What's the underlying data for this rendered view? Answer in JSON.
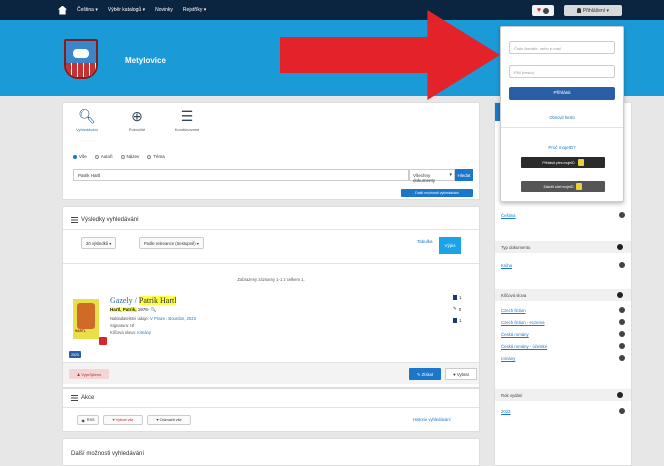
{
  "topnav": {
    "items": [
      "Čeština ▾",
      "Výběr katalogů ▾",
      "Novinky",
      "Rejstříky ▾"
    ],
    "login_button": "Přihlášení ▾"
  },
  "header": {
    "site_title": "Metylovice"
  },
  "search": {
    "tabs": [
      "Vyhledávání",
      "Pokročilé",
      "Kombinované"
    ],
    "scope_options": [
      "Vše",
      "Autoři",
      "Název",
      "Téma"
    ],
    "query_value": "Patrik Hartl",
    "type_select": "Všechny dokumenty",
    "search_button": "Hledat",
    "more_options": "Další možnosti vyhledávání"
  },
  "results": {
    "title": "Výsledky vyhledávání",
    "per_page": "20 výsledků ▾",
    "sort": "Podle relevance (Sestupně) ▾",
    "view_table": "Tabulka",
    "view_list": "Výpis",
    "shown_text": "Zobrazeny záznamy 1-1 z celkem 1.",
    "record": {
      "title_prefix": "Gazely / ",
      "title_highlight": "Patrik Hartl",
      "author_bold": "Hartl, Patrik,",
      "author_rest": " 1976- 🔍",
      "line1_label": "Nakladatelství údaje: ",
      "line1_link": "V Praze : Bourdon, 2023",
      "line2": "Signatura: Hf",
      "line3_label": "Klíčová slova: ",
      "line3_link": "romány",
      "year_badge": "2023",
      "cover_tag": "HARTL",
      "side_icons": [
        "1",
        "0",
        "1"
      ],
      "saved_btn": "♟ Vyprůjčeno",
      "detail_btn": "✎ Získat",
      "select_btn": "♥ Vybrat"
    }
  },
  "actions": {
    "title": "Akce",
    "buttons": [
      "RSS",
      "♥ Vybrat vše",
      "♥ Odznačit vše"
    ],
    "history_link": "Historie vyhledávání"
  },
  "more_search": {
    "title": "Další možnosti vyhledávání"
  },
  "sidebar": {
    "sections": [
      {
        "head": "",
        "rows": [
          "Čeština"
        ]
      },
      {
        "head": "Typ dokumentu",
        "rows": [
          "Kniha"
        ]
      },
      {
        "head": "Klíčová slova",
        "rows": [
          "Czech fiction",
          "Czech fiction - eczema",
          "Česká romány",
          "Česká romány - účelské",
          "romány"
        ]
      },
      {
        "head": "Rok vydání",
        "rows": [
          "2023"
        ]
      }
    ]
  },
  "login_dropdown": {
    "card_placeholder": "Číslo čtenáře, nebo e-mail",
    "pin_placeholder": "PIN (heslo)",
    "login_button": "Přihlásit",
    "reset_link": "Obnovit heslo",
    "why_link": "Proč mojeID?",
    "mojeid_login": "Přihlásit přes mojeID",
    "mojeid_register": "Založit účet mojeID"
  },
  "colors": {
    "topnav": "#0b2440",
    "header": "#1a9bd7",
    "primary": "#1a77c9",
    "arrow": "#e4222a",
    "highlight": "#ffff4a"
  }
}
